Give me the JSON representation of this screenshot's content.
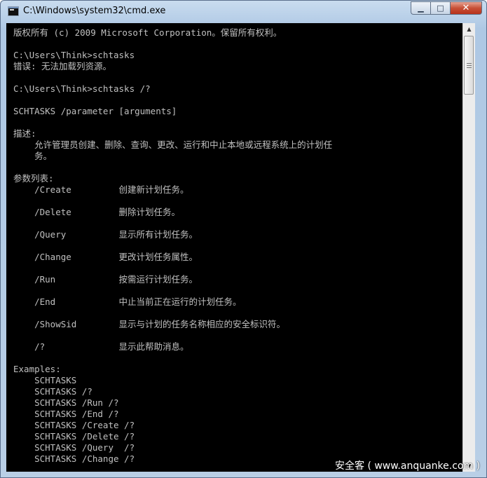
{
  "window": {
    "title": "C:\\Windows\\system32\\cmd.exe",
    "minimize_label": "▁",
    "maximize_label": "□",
    "close_label": "✕"
  },
  "console": {
    "lines": [
      "版权所有 (c) 2009 Microsoft Corporation。保留所有权利。",
      "",
      "C:\\Users\\Think>schtasks",
      "错误: 无法加载列资源。",
      "",
      "C:\\Users\\Think>schtasks /?",
      "",
      "SCHTASKS /parameter [arguments]",
      "",
      "描述:",
      "    允许管理员创建、删除、查询、更改、运行和中止本地或远程系统上的计划任",
      "    务。",
      "",
      "参数列表:",
      "    /Create         创建新计划任务。",
      "",
      "    /Delete         删除计划任务。",
      "",
      "    /Query          显示所有计划任务。",
      "",
      "    /Change         更改计划任务属性。",
      "",
      "    /Run            按需运行计划任务。",
      "",
      "    /End            中止当前正在运行的计划任务。",
      "",
      "    /ShowSid        显示与计划的任务名称相应的安全标识符。",
      "",
      "    /?              显示此帮助消息。",
      "",
      "Examples:",
      "    SCHTASKS",
      "    SCHTASKS /?",
      "    SCHTASKS /Run /?",
      "    SCHTASKS /End /?",
      "    SCHTASKS /Create /?",
      "    SCHTASKS /Delete /?",
      "    SCHTASKS /Query  /?",
      "    SCHTASKS /Change /?"
    ]
  },
  "watermark": "安全客 ( www.anquanke.com )",
  "icons": {
    "app": "cmd-icon",
    "scroll_up": "scroll-up-arrow-icon",
    "scroll_down": "scroll-down-arrow-icon"
  },
  "colors": {
    "console_bg": "#000000",
    "console_fg": "#c0c0c0",
    "close_button": "#c75037"
  }
}
